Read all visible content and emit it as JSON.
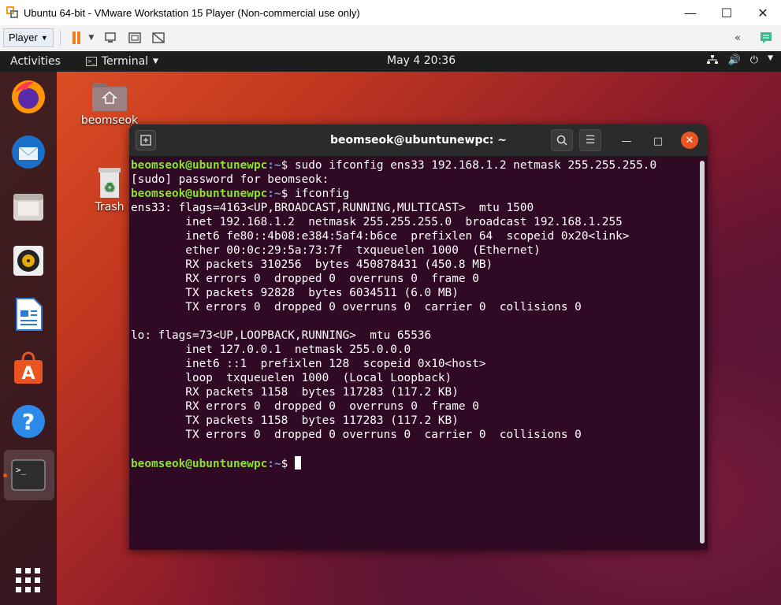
{
  "vmware": {
    "title": "Ubuntu 64-bit - VMware Workstation 15 Player (Non-commercial use only)",
    "player_label": "Player"
  },
  "topbar": {
    "activities": "Activities",
    "app_menu": "Terminal",
    "clock": "May 4  20:36"
  },
  "desktop_icons": {
    "home": "beomseok",
    "trash": "Trash"
  },
  "terminal": {
    "title": "beomseok@ubuntunewpc: ~",
    "prompt_user": "beomseok@ubuntunewpc",
    "prompt_path": ":~",
    "prompt_symbol": "$ ",
    "lines": [
      {
        "type": "cmd",
        "text": "sudo ifconfig ens33 192.168.1.2 netmask 255.255.255.0"
      },
      {
        "type": "out",
        "text": "[sudo] password for beomseok:"
      },
      {
        "type": "cmd",
        "text": "ifconfig"
      },
      {
        "type": "out",
        "text": "ens33: flags=4163<UP,BROADCAST,RUNNING,MULTICAST>  mtu 1500"
      },
      {
        "type": "out",
        "text": "        inet 192.168.1.2  netmask 255.255.255.0  broadcast 192.168.1.255"
      },
      {
        "type": "out",
        "text": "        inet6 fe80::4b08:e384:5af4:b6ce  prefixlen 64  scopeid 0x20<link>"
      },
      {
        "type": "out",
        "text": "        ether 00:0c:29:5a:73:7f  txqueuelen 1000  (Ethernet)"
      },
      {
        "type": "out",
        "text": "        RX packets 310256  bytes 450878431 (450.8 MB)"
      },
      {
        "type": "out",
        "text": "        RX errors 0  dropped 0  overruns 0  frame 0"
      },
      {
        "type": "out",
        "text": "        TX packets 92828  bytes 6034511 (6.0 MB)"
      },
      {
        "type": "out",
        "text": "        TX errors 0  dropped 0 overruns 0  carrier 0  collisions 0"
      },
      {
        "type": "out",
        "text": ""
      },
      {
        "type": "out",
        "text": "lo: flags=73<UP,LOOPBACK,RUNNING>  mtu 65536"
      },
      {
        "type": "out",
        "text": "        inet 127.0.0.1  netmask 255.0.0.0"
      },
      {
        "type": "out",
        "text": "        inet6 ::1  prefixlen 128  scopeid 0x10<host>"
      },
      {
        "type": "out",
        "text": "        loop  txqueuelen 1000  (Local Loopback)"
      },
      {
        "type": "out",
        "text": "        RX packets 1158  bytes 117283 (117.2 KB)"
      },
      {
        "type": "out",
        "text": "        RX errors 0  dropped 0  overruns 0  frame 0"
      },
      {
        "type": "out",
        "text": "        TX packets 1158  bytes 117283 (117.2 KB)"
      },
      {
        "type": "out",
        "text": "        TX errors 0  dropped 0 overruns 0  carrier 0  collisions 0"
      },
      {
        "type": "out",
        "text": ""
      },
      {
        "type": "cmd",
        "text": ""
      }
    ]
  },
  "colors": {
    "terminal_bg": "#300a24",
    "prompt_user": "#8ae234",
    "prompt_path": "#729fcf",
    "ubuntu_orange": "#e95420"
  }
}
